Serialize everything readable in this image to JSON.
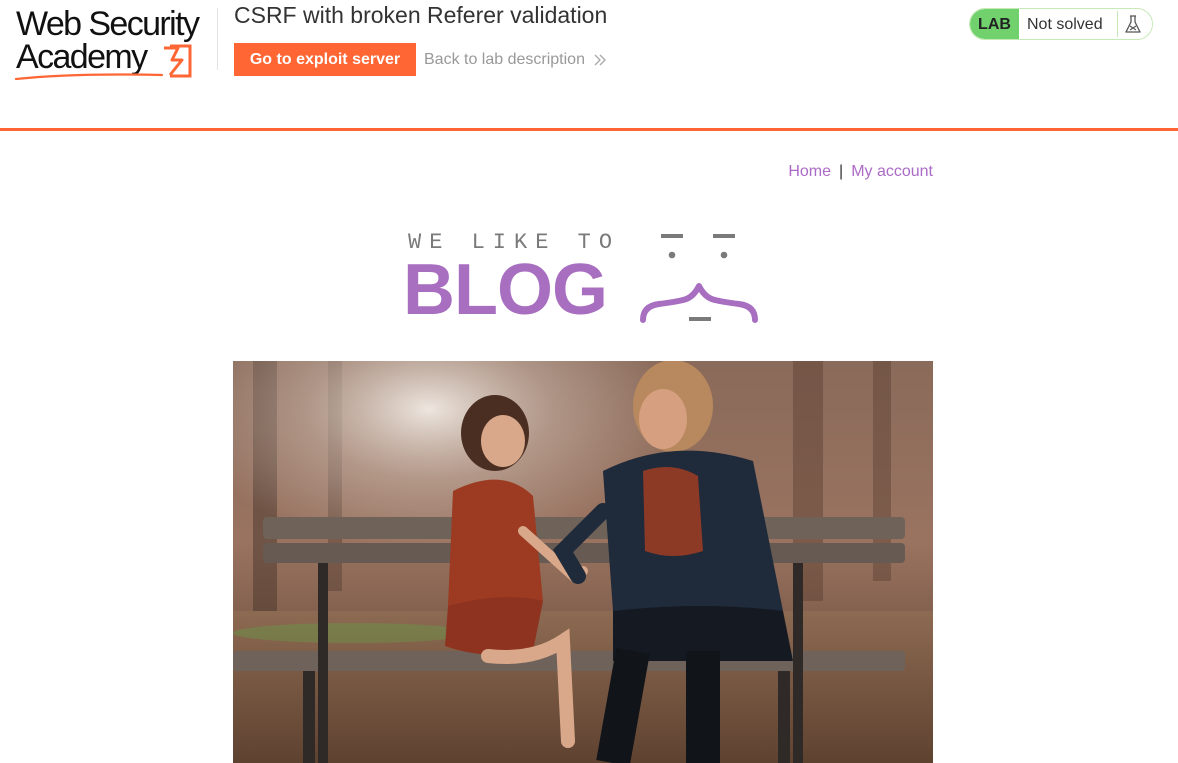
{
  "academy": {
    "logo_line1": "Web Security",
    "logo_line2": "Academy",
    "lab_title": "CSRF with broken Referer validation",
    "exploit_button": "Go to exploit server",
    "back_link": "Back to lab description",
    "status_label": "LAB",
    "status_text": "Not solved",
    "icons": {
      "logo_mark": "lightning-bracket-icon",
      "back_chevron": "double-chevron-right-icon",
      "status": "flask-icon"
    },
    "colors": {
      "accent": "#ff6633",
      "status_green": "#70d16d",
      "link_purple": "#ab6bc6"
    }
  },
  "nav": {
    "home": "Home",
    "separator": "|",
    "account": "My account"
  },
  "banner": {
    "tagline": "WE LIKE TO",
    "word": "BLOG",
    "colors": {
      "word": "#a86ec0",
      "tagline": "#7a7a7a"
    }
  },
  "post": {
    "image_subject": "woman and girl laughing on a park bench"
  }
}
